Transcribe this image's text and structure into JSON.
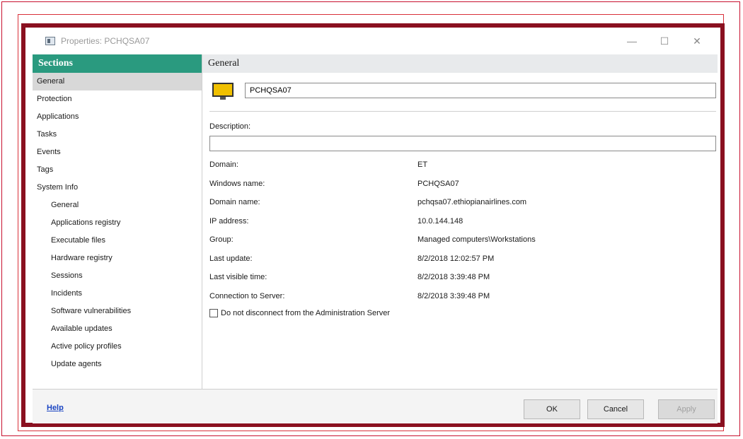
{
  "window": {
    "title": "Properties: PCHQSA07",
    "controls": {
      "minimize": "—",
      "maximize": "☐",
      "close": "✕"
    }
  },
  "sidebar": {
    "header": "Sections",
    "items": [
      {
        "label": "General",
        "selected": true,
        "sub": false
      },
      {
        "label": "Protection",
        "sub": false
      },
      {
        "label": "Applications",
        "sub": false
      },
      {
        "label": "Tasks",
        "sub": false
      },
      {
        "label": "Events",
        "sub": false
      },
      {
        "label": "Tags",
        "sub": false
      },
      {
        "label": "System Info",
        "sub": false
      },
      {
        "label": "General",
        "sub": true
      },
      {
        "label": "Applications registry",
        "sub": true
      },
      {
        "label": "Executable files",
        "sub": true
      },
      {
        "label": "Hardware registry",
        "sub": true
      },
      {
        "label": "Sessions",
        "sub": true
      },
      {
        "label": "Incidents",
        "sub": true
      },
      {
        "label": "Software vulnerabilities",
        "sub": true
      },
      {
        "label": "Available updates",
        "sub": true
      },
      {
        "label": "Active policy profiles",
        "sub": true
      },
      {
        "label": "Update agents",
        "sub": true
      }
    ]
  },
  "content": {
    "header": "General",
    "computer_name": "PCHQSA07",
    "description_label": "Description:",
    "description_value": "",
    "properties": [
      {
        "label": "Domain:",
        "value": "ET"
      },
      {
        "label": "Windows name:",
        "value": "PCHQSA07"
      },
      {
        "label": "Domain name:",
        "value": "pchqsa07.ethiopianairlines.com"
      },
      {
        "label": "IP address:",
        "value": "10.0.144.148"
      },
      {
        "label": "Group:",
        "value": "Managed computers\\Workstations"
      },
      {
        "label": "Last update:",
        "value": "8/2/2018 12:02:57 PM"
      },
      {
        "label": "Last visible time:",
        "value": "8/2/2018 3:39:48 PM"
      },
      {
        "label": "Connection to Server:",
        "value": "8/2/2018 3:39:48 PM"
      }
    ],
    "checkbox_label": "Do not disconnect from the Administration Server",
    "checkbox_checked": false
  },
  "footer": {
    "help": "Help",
    "ok": "OK",
    "cancel": "Cancel",
    "apply": "Apply"
  },
  "colors": {
    "sections_header": "#2a9a7f",
    "frame": "#8a1020",
    "help_link": "#1a44c2"
  }
}
